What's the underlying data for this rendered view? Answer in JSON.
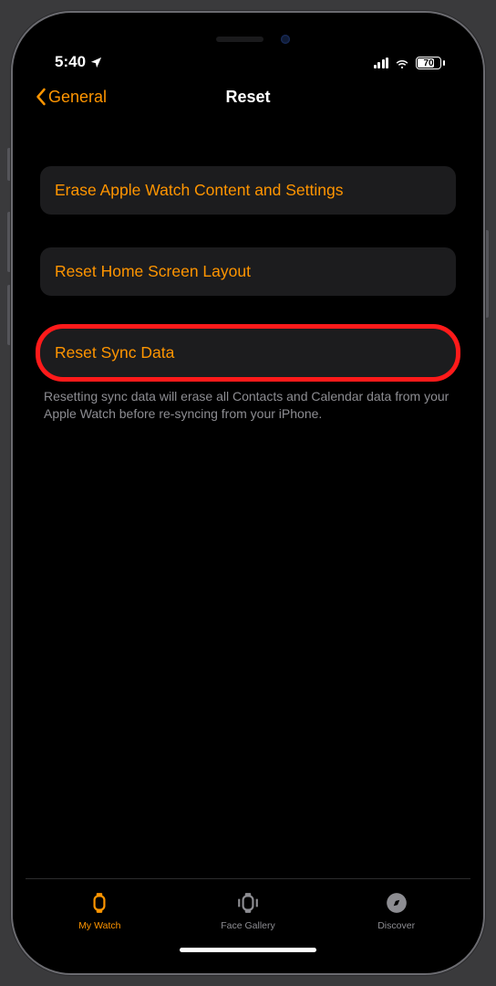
{
  "status": {
    "time": "5:40",
    "battery_pct": "70"
  },
  "nav": {
    "back_label": "General",
    "title": "Reset"
  },
  "rows": {
    "erase": "Erase Apple Watch Content and Settings",
    "home_layout": "Reset Home Screen Layout",
    "sync": "Reset Sync Data"
  },
  "footer": "Resetting sync data will erase all Contacts and Calendar data from your Apple Watch before re-syncing from your iPhone.",
  "tabs": {
    "watch": "My Watch",
    "gallery": "Face Gallery",
    "discover": "Discover"
  }
}
